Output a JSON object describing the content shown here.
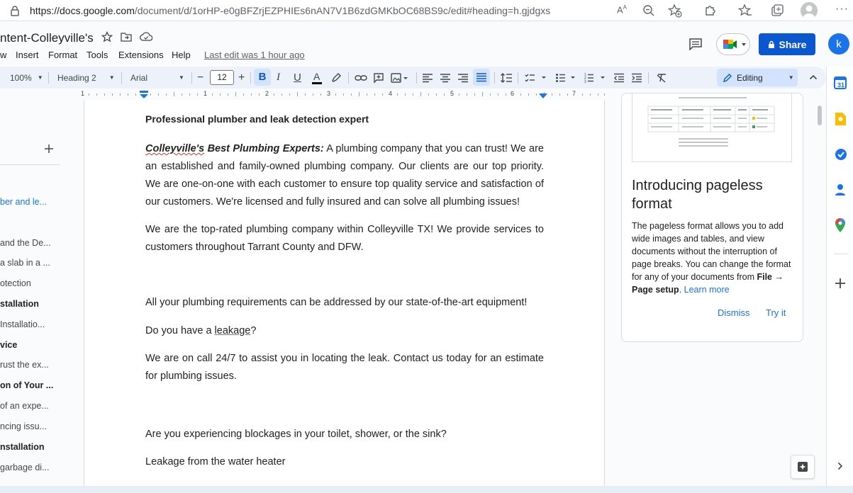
{
  "browser": {
    "url_host": "https://docs.google.com",
    "url_path": "/document/d/1orHP-e0gBFZrjEZPHIEs6nAN7V1B6zdGMKbOC68BS9c/edit#heading=h.gjdgxs"
  },
  "header": {
    "doc_title": "ntent-Colleyville's",
    "menus": [
      "w",
      "Insert",
      "Format",
      "Tools",
      "Extensions",
      "Help"
    ],
    "last_edit": "Last edit was 1 hour ago",
    "share_label": "Share",
    "avatar_letter": "k"
  },
  "toolbar": {
    "zoom": "100%",
    "style": "Heading 2",
    "font": "Arial",
    "font_size": "12",
    "editing_label": "Editing"
  },
  "ruler": {
    "numbers": [
      "1",
      "1",
      "2",
      "3",
      "4",
      "5",
      "6",
      "7"
    ]
  },
  "outline": {
    "items": [
      {
        "label": "ber and le...",
        "style": "active"
      },
      {
        "label": "and the De...",
        "style": "normal"
      },
      {
        "label": "a slab in a ...",
        "style": "normal"
      },
      {
        "label": "otection",
        "style": "normal"
      },
      {
        "label": "stallation",
        "style": "bold"
      },
      {
        "label": "Installatio...",
        "style": "normal"
      },
      {
        "label": "vice",
        "style": "bold"
      },
      {
        "label": "rust the ex...",
        "style": "normal"
      },
      {
        "label": "on of Your ...",
        "style": "bold"
      },
      {
        "label": "of an expe...",
        "style": "normal"
      },
      {
        "label": "ncing issu...",
        "style": "normal"
      },
      {
        "label": "nstallation",
        "style": "bold"
      },
      {
        "label": "garbage di...",
        "style": "normal"
      }
    ]
  },
  "document": {
    "heading": "Professional plumber and leak detection expert",
    "p1_lead_a": "Colleyville's",
    "p1_lead_b": " Best Plumbing Experts:",
    "p1_text": " A plumbing company that you can trust! We are an established and family-owned plumbing company. Our clients are our top priority. We are one-on-one with each customer to ensure top quality service and satisfaction of our customers. We're licensed and fully insured and can solve all plumbing issues!",
    "p2": "We are the top-rated plumbing company within Colleyville TX! We provide services to customers throughout Tarrant County and DFW.",
    "p3": "All your plumbing requirements can be addressed by our state-of-the-art equipment!",
    "p4_a": "Do you have a ",
    "p4_b": "leakage",
    "p4_c": "?",
    "p5": "We are on call 24/7 to assist you in locating the leak. Contact us today for an estimate for plumbing issues.",
    "p6": "Are you experiencing blockages in your toilet, shower, or the sink?",
    "p7": "Leakage from the water heater"
  },
  "panel": {
    "title": "Introducing pageless format",
    "body_a": "The pageless format allows you to add wide images and tables, and view documents without the interruption of page breaks. You can change the format for any of your documents from ",
    "body_bold": "File → Page setup",
    "body_b": ". ",
    "learn_more": "Learn more",
    "dismiss": "Dismiss",
    "try_it": "Try it"
  },
  "colors": {
    "accent": "#1a73e8",
    "share": "#0b57d0",
    "toolbar_bg": "#edf2fa",
    "selected_bg": "#d3e3fd"
  },
  "icons": [
    "lock-icon",
    "read-aloud-icon",
    "zoom-out-icon",
    "add-favorite-icon",
    "extensions-icon",
    "favorites-icon",
    "collections-icon",
    "profile-icon",
    "star-icon",
    "move-folder-icon",
    "cloud-status-icon",
    "comments-icon",
    "meet-icon",
    "share-lock-icon",
    "calendar-icon",
    "keep-icon",
    "tasks-icon",
    "contacts-icon",
    "maps-icon",
    "plus-icon",
    "chevron-right-icon",
    "explore-icon"
  ]
}
